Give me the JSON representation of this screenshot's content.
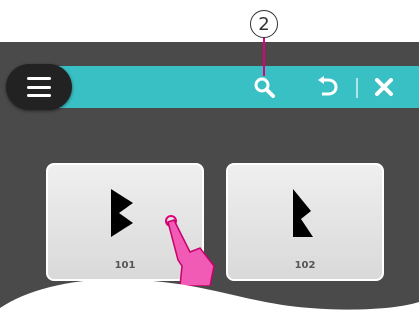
{
  "callout": {
    "number": "2"
  },
  "toolbar": {
    "menu_icon": "menu-icon",
    "search_icon": "search-icon",
    "back_icon": "undo-arrow-icon",
    "close_icon": "close-icon",
    "accent_color": "#39c0c4"
  },
  "cards": [
    {
      "label": "101",
      "icon": "stitch-101-icon"
    },
    {
      "label": "102",
      "icon": "stitch-102-icon"
    }
  ],
  "touch": {
    "icon": "pointing-hand-icon",
    "color": "#e0007a"
  }
}
